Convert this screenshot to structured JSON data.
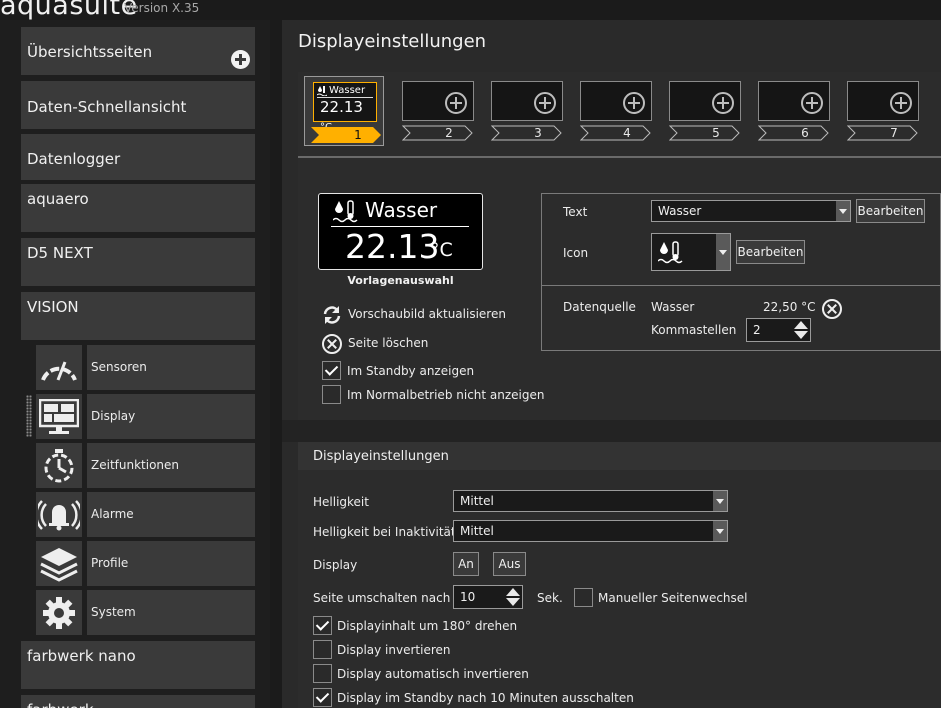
{
  "app": {
    "name": "aquasuite",
    "version": "Version X.35"
  },
  "sidebar": {
    "items": [
      {
        "label": "Übersichtsseiten"
      },
      {
        "label": "Daten-Schnellansicht"
      },
      {
        "label": "Datenlogger"
      },
      {
        "label": "aquaero"
      },
      {
        "label": "D5 NEXT"
      },
      {
        "label": "VISION"
      }
    ],
    "vision_sub": [
      {
        "label": "Sensoren",
        "icon": "gauge-icon"
      },
      {
        "label": "Display",
        "icon": "display-icon"
      },
      {
        "label": "Zeitfunktionen",
        "icon": "timer-icon"
      },
      {
        "label": "Alarme",
        "icon": "alarm-bell-icon"
      },
      {
        "label": "Profile",
        "icon": "layers-icon"
      },
      {
        "label": "System",
        "icon": "gear-icon"
      }
    ],
    "after": [
      {
        "label": "farbwerk nano"
      },
      {
        "label": "farbwerk"
      }
    ]
  },
  "main": {
    "title": "Displayeinstellungen",
    "tabs": [
      {
        "num": "1",
        "active": true,
        "title": "Wasser",
        "value": "22.13",
        "unit": "°C"
      },
      {
        "num": "2"
      },
      {
        "num": "3"
      },
      {
        "num": "4"
      },
      {
        "num": "5"
      },
      {
        "num": "6"
      },
      {
        "num": "7"
      }
    ],
    "preview": {
      "title": "Wasser",
      "value": "22.13",
      "unit": "°C",
      "template_label": "Vorlagenauswahl"
    },
    "actions": {
      "refresh": "Vorschaubild aktualisieren",
      "delete": "Seite löschen",
      "standby_show": "Im Standby anzeigen",
      "standby_show_checked": true,
      "normal_hide": "Im Normalbetrieb nicht anzeigen",
      "normal_hide_checked": false
    },
    "props": {
      "text_label": "Text",
      "text_value": "Wasser",
      "edit_label": "Bearbeiten",
      "icon_label": "Icon",
      "source_label": "Datenquelle",
      "source_name": "Wasser",
      "source_value": "22,50 °C",
      "decimals_label": "Kommastellen",
      "decimals_value": "2"
    },
    "settings": {
      "title": "Displayeinstellungen",
      "brightness_label": "Helligkeit",
      "brightness_value": "Mittel",
      "brightness_idle_label": "Helligkeit bei Inaktivität",
      "brightness_idle_value": "Mittel",
      "display_label": "Display",
      "on_label": "An",
      "off_label": "Aus",
      "switch_label": "Seite umschalten nach",
      "switch_value": "10",
      "switch_unit": "Sek.",
      "manual_label": "Manueller Seitenwechsel",
      "manual_checked": false,
      "rotate_label": "Displayinhalt um 180° drehen",
      "rotate_checked": true,
      "invert_label": "Display invertieren",
      "invert_checked": false,
      "auto_invert_label": "Display automatisch invertieren",
      "auto_invert_checked": false,
      "standby_off_label": "Display im Standby nach 10 Minuten ausschalten",
      "standby_off_checked": true
    }
  },
  "colors": {
    "accent": "#ffb000",
    "panel": "#2c2c2c",
    "item": "#3a3a3a"
  }
}
